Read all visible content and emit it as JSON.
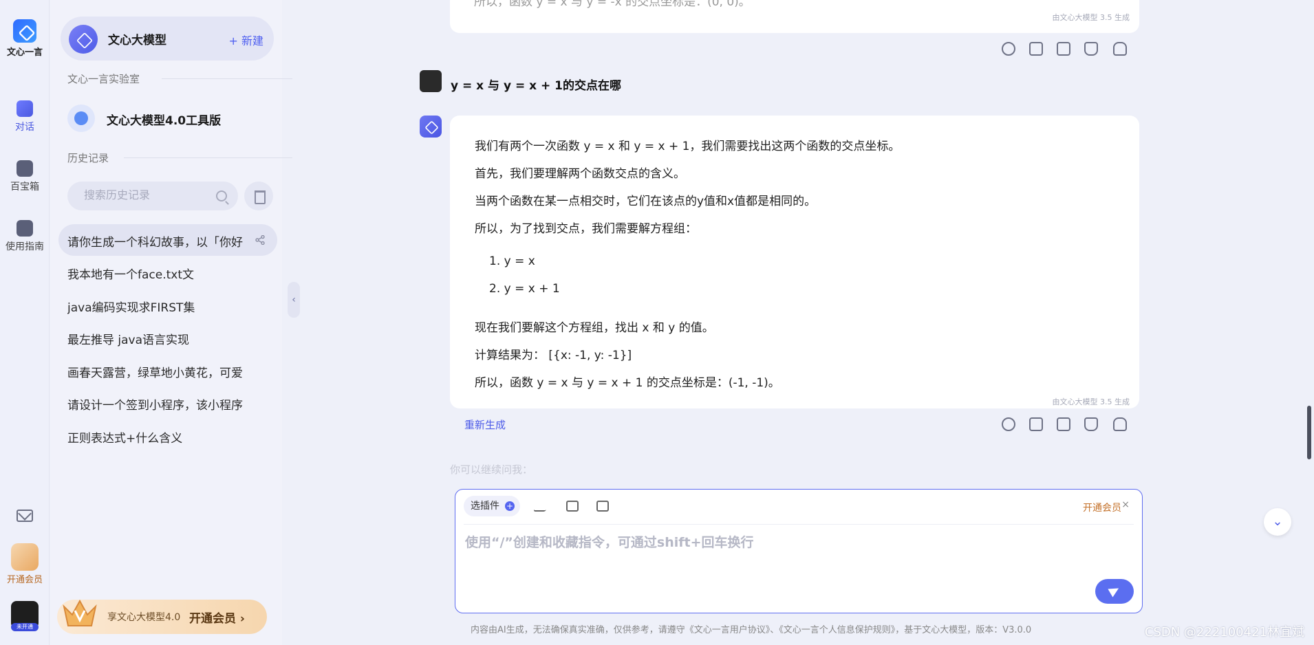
{
  "rail": {
    "logo_label": "文心一言",
    "items": [
      {
        "label": "对话",
        "icon": "chat-icon"
      },
      {
        "label": "百宝箱",
        "icon": "toolbox-icon"
      },
      {
        "label": "使用指南",
        "icon": "guide-icon"
      }
    ],
    "vip_label": "开通会员",
    "avatar_badge": "未开通"
  },
  "sidebar": {
    "model_name": "文心大模型",
    "new_label": "+ 新建",
    "lab_title": "文心一言实验室",
    "tool_name": "文心大模型4.0工具版",
    "history_title": "历史记录",
    "search_placeholder": "搜索历史记录",
    "history": [
      "请你生成一个科幻故事，以「你好",
      "我本地有一个face.txt文",
      "java编码实现求FIRST集",
      "最左推导 java语言实现",
      "画春天露营，绿草地小黄花，可爱",
      "请设计一个签到小程序，该小程序",
      "正则表达式+什么含义"
    ],
    "promo_text": "享文心大模型4.0",
    "promo_cta": "开通会员 ›"
  },
  "chat": {
    "prev_cut_text": "所以，函数 y = x 与 y = -x 的交点坐标是：(0, 0)。",
    "gen_tag": "由文心大模型 3.5 生成",
    "user_question": "y = x  与 y  = x + 1的交点在哪",
    "answer": {
      "p1": "我们有两个一次函数 y = x 和 y = x + 1，我们需要找出这两个函数的交点坐标。",
      "p2": "首先，我们要理解两个函数交点的含义。",
      "p3": "当两个函数在某一点相交时，它们在该点的y值和x值都是相同的。",
      "p4": "所以，为了找到交点，我们需要解方程组：",
      "li1": "1. y = x",
      "li2": "2. y = x + 1",
      "p5": "现在我们要解这个方程组，找出 x 和 y 的值。",
      "p6": "计算结果为：  [{x: -1, y: -1}]",
      "p7": "所以，函数 y = x 与 y = x + 1 的交点坐标是：(-1, -1)。"
    },
    "regen_label": "重新生成",
    "hint": "你可以继续问我："
  },
  "composer": {
    "plugin_label": "选插件",
    "vip_label": "开通会员",
    "placeholder": "使用“/”创建和收藏指令，可通过shift+回车换行"
  },
  "footer": "内容由AI生成，无法确保真实准确，仅供参考，请遵守《文心一言用户协议》、《文心一言个人信息保护规则》，基于文心大模型，版本：V3.0.0",
  "watermark": "CSDN @222100421林宜斌",
  "colors": {
    "accent": "#4e5ce8",
    "vip": "#c4712a",
    "background": "#eef0f9"
  }
}
